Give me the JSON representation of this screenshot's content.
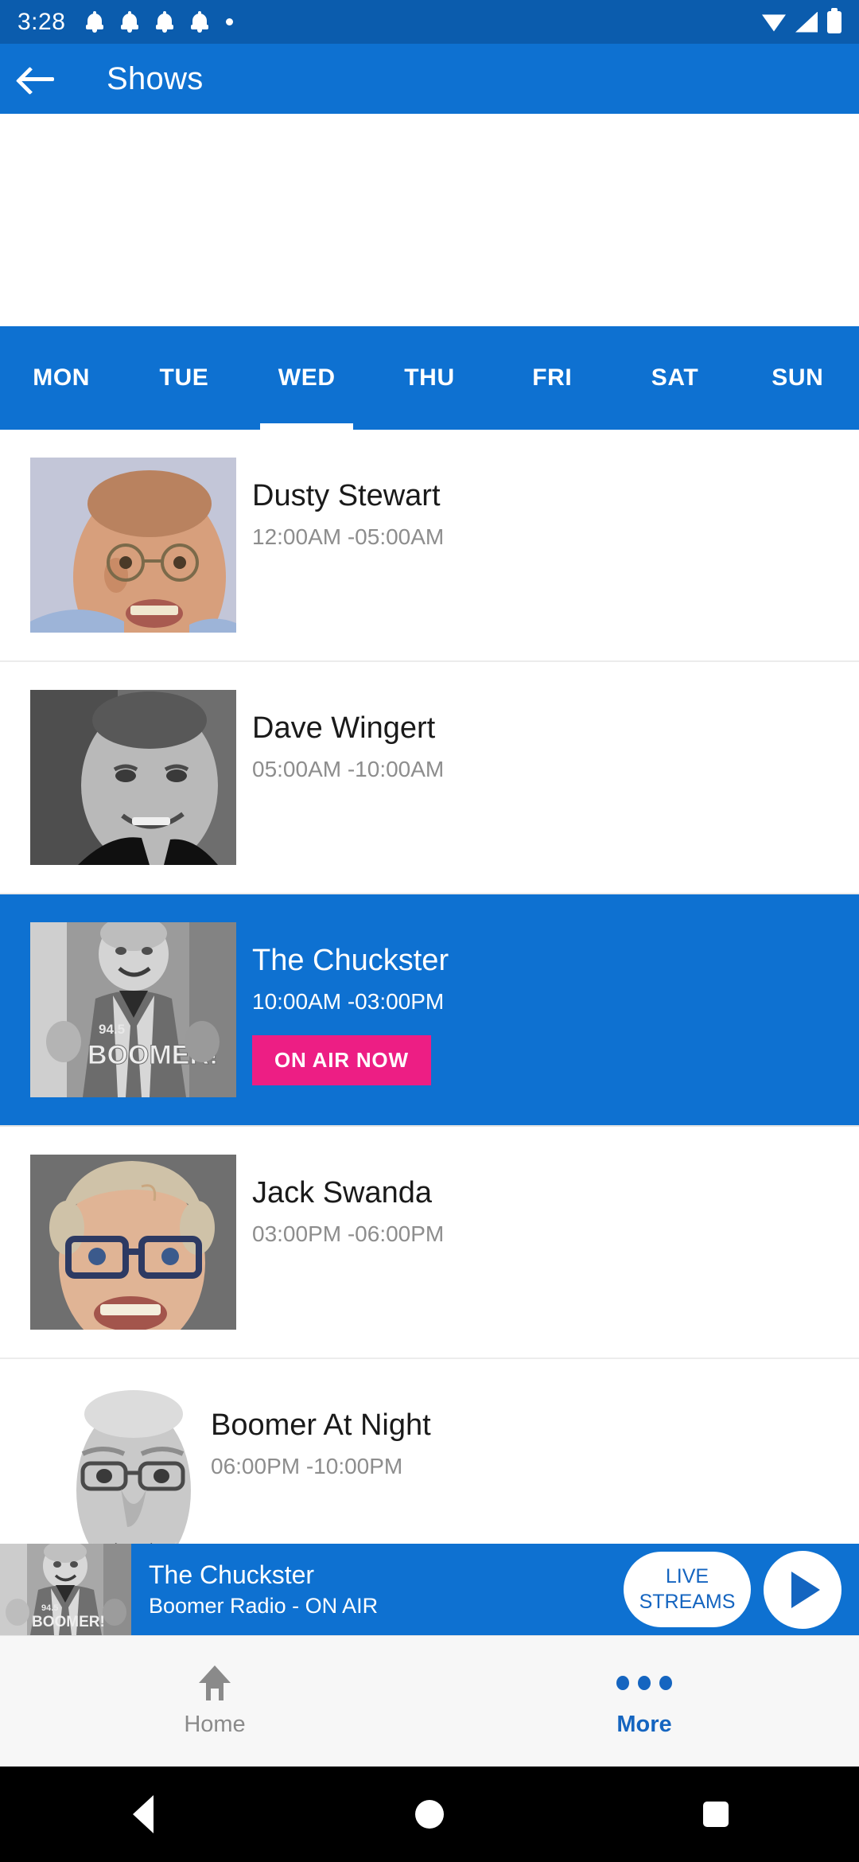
{
  "status_bar": {
    "time": "3:28",
    "icons_left": [
      "bell-icon",
      "bell-icon",
      "bell-icon",
      "bell-icon",
      "dot-icon"
    ],
    "icons_right": [
      "wifi-icon",
      "signal-icon",
      "battery-icon"
    ]
  },
  "app_bar": {
    "back_icon": "back-arrow-icon",
    "title": "Shows"
  },
  "tabs": {
    "items": [
      {
        "label": "MON",
        "active": false
      },
      {
        "label": "TUE",
        "active": false
      },
      {
        "label": "WED",
        "active": true
      },
      {
        "label": "THU",
        "active": false
      },
      {
        "label": "FRI",
        "active": false
      },
      {
        "label": "SAT",
        "active": false
      },
      {
        "label": "SUN",
        "active": false
      }
    ],
    "selected": "WED"
  },
  "shows": [
    {
      "name": "Dusty Stewart",
      "time": "12:00AM -05:00AM",
      "on_air": false,
      "badge": "",
      "thumb": "headshot-dusty-stewart"
    },
    {
      "name": "Dave Wingert",
      "time": "05:00AM -10:00AM",
      "on_air": false,
      "badge": "",
      "thumb": "headshot-dave-wingert"
    },
    {
      "name": "The Chuckster",
      "time": "10:00AM -03:00PM",
      "on_air": true,
      "badge": "ON AIR NOW",
      "thumb": "photo-chuckster-boomer-jersey"
    },
    {
      "name": "Jack Swanda",
      "time": "03:00PM -06:00PM",
      "on_air": false,
      "badge": "",
      "thumb": "headshot-jack-swanda"
    },
    {
      "name": "Boomer At Night",
      "time": "06:00PM -10:00PM",
      "on_air": false,
      "badge": "",
      "thumb": "headshot-boomer-at-night"
    }
  ],
  "player": {
    "thumb": "photo-chuckster-boomer-jersey",
    "title": "The Chuckster",
    "subtitle": "Boomer Radio - ON AIR",
    "live_streams_line1": "LIVE",
    "live_streams_line2": "STREAMS",
    "play_icon": "play-icon"
  },
  "bottom_nav": {
    "items": [
      {
        "label": "Home",
        "icon": "home-icon",
        "active": false
      },
      {
        "label": "More",
        "icon": "three-dots-icon",
        "active": true
      }
    ]
  },
  "android_nav": {
    "back": "triangle-back-icon",
    "home": "circle-home-icon",
    "recents": "square-recents-icon"
  },
  "colors": {
    "status_bar": "#0B5CAD",
    "primary": "#0E71D1",
    "accent_pink": "#ED1E84",
    "nav_active": "#1565C0",
    "nav_inactive": "#8A8A8A"
  }
}
